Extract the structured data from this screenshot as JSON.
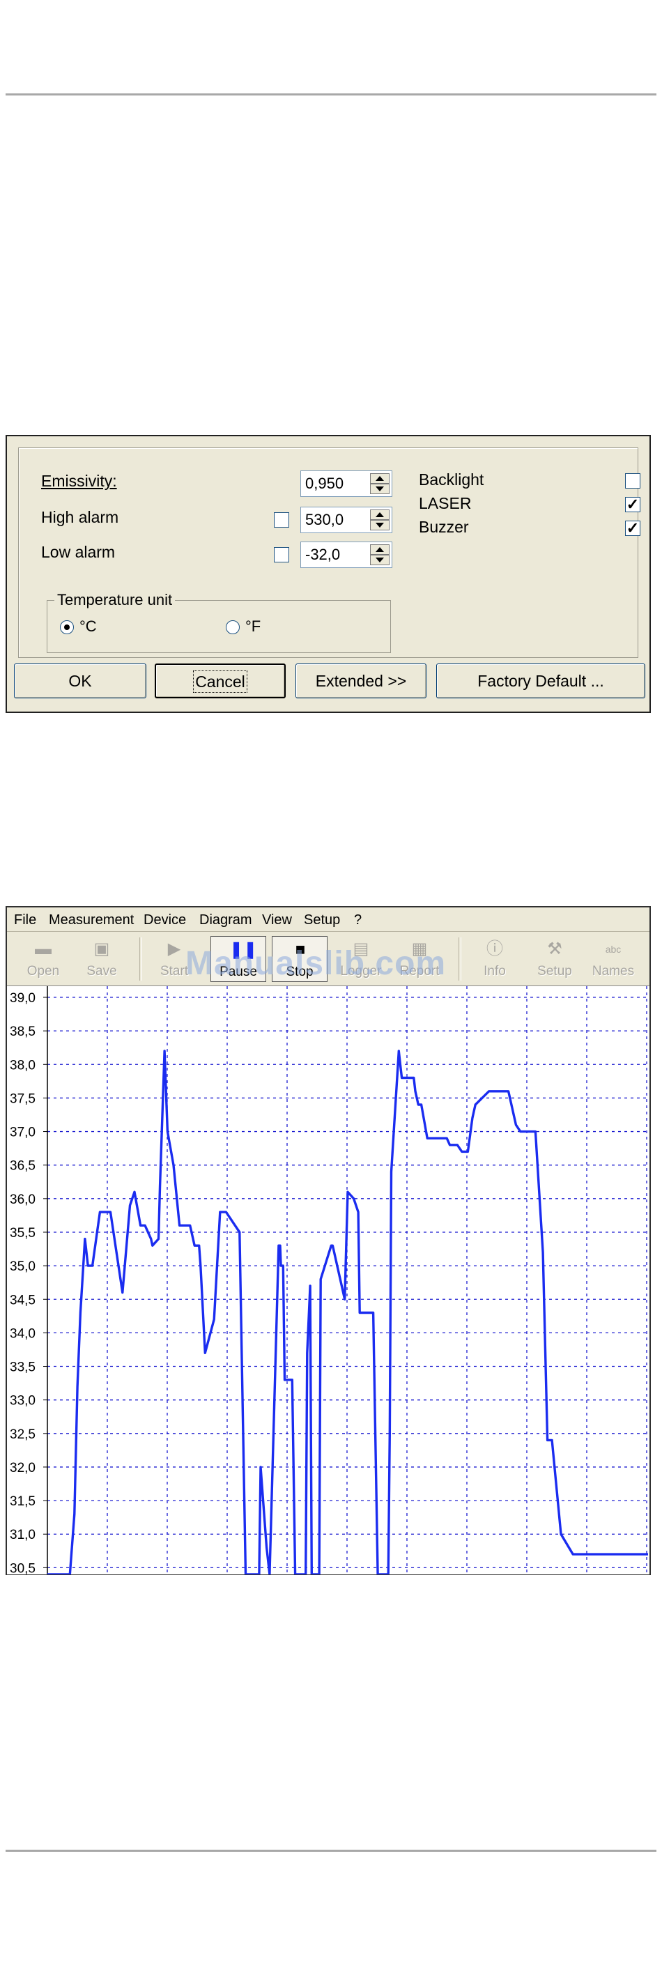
{
  "dialog": {
    "fields": [
      {
        "label": "Emissivity:",
        "value": "0,950",
        "alarm_checked": null
      },
      {
        "label": "High alarm",
        "value": "530,0",
        "alarm_checked": false
      },
      {
        "label": "Low alarm",
        "value": "-32,0",
        "alarm_checked": false
      }
    ],
    "options": [
      {
        "label": "Backlight",
        "checked": false
      },
      {
        "label": "LASER",
        "checked": true
      },
      {
        "label": "Buzzer",
        "checked": true
      }
    ],
    "temperature_unit": {
      "title": "Temperature unit",
      "celsius_label": "°C",
      "fahrenheit_label": "°F",
      "selected": "°C"
    },
    "buttons": {
      "ok": "OK",
      "cancel": "Cancel",
      "extended": "Extended >>",
      "factory_default": "Factory Default ..."
    }
  },
  "app": {
    "menu": [
      "File",
      "Measurement",
      "Device",
      "Diagram",
      "View",
      "Setup",
      "?"
    ],
    "toolbar": [
      {
        "label": "Open",
        "icon": "folder-icon",
        "enabled": false
      },
      {
        "label": "Save",
        "icon": "disk-icon",
        "enabled": false
      },
      {
        "label": "Start",
        "icon": "play-icon",
        "enabled": false
      },
      {
        "label": "Pause",
        "icon": "pause-icon",
        "enabled": true
      },
      {
        "label": "Stop",
        "icon": "stop-icon",
        "enabled": true
      },
      {
        "label": "Logger",
        "icon": "logger-icon",
        "enabled": false
      },
      {
        "label": "Report",
        "icon": "report-icon",
        "enabled": false
      },
      {
        "label": "Info",
        "icon": "info-icon",
        "enabled": false
      },
      {
        "label": "Setup",
        "icon": "tools-icon",
        "enabled": false
      },
      {
        "label": "Names",
        "icon": "names-icon",
        "enabled": false
      }
    ],
    "watermark": "Manualslib.com"
  },
  "chart_data": {
    "type": "line",
    "title": "",
    "xlabel": "",
    "ylabel": "",
    "ylim": [
      30.4,
      39.0
    ],
    "y_ticks": [
      "39,0",
      "38,5",
      "38,0",
      "37,5",
      "37,0",
      "36,5",
      "36,0",
      "35,5",
      "35,0",
      "34,5",
      "34,0",
      "33,5",
      "33,0",
      "32,5",
      "32,0",
      "31,5",
      "31,0",
      "30,5"
    ],
    "grid": true,
    "line_color": "#1a2cf0",
    "series": [
      {
        "x": [
          0,
          10,
          13,
          15,
          18,
          20,
          22,
          25,
          27,
          30,
          35,
          42,
          50,
          55,
          58,
          62,
          65,
          67,
          69,
          70,
          74,
          75,
          78,
          80,
          84,
          88,
          90,
          93,
          95,
          98,
          101,
          102,
          105,
          111,
          115,
          119,
          128,
          132,
          136,
          137,
          141,
          142,
          146,
          148,
          154,
          155,
          155.5,
          157,
          158,
          163,
          165,
          167,
          172,
          173,
          175,
          176,
          178,
          181,
          182,
          189,
          190,
          198,
          200,
          204,
          207,
          208,
          217,
          220,
          226,
          227,
          228,
          229,
          234,
          235,
          236,
          243,
          244,
          245,
          247,
          249,
          253,
          258,
          261,
          262,
          264,
          266,
          268,
          270,
          273,
          276,
          278,
          280,
          283,
          285,
          294,
          304,
          307,
          312,
          315,
          325,
          330,
          333,
          336,
          342,
          350,
          356,
          358,
          364,
          366,
          370,
          390,
          400
        ],
        "values": [
          30.4,
          30.4,
          30.4,
          30.4,
          31.3,
          33.2,
          34.3,
          35.4,
          35.0,
          35.0,
          35.8,
          35.8,
          34.6,
          35.9,
          36.1,
          35.6,
          35.6,
          35.5,
          35.4,
          35.3,
          35.4,
          36.2,
          38.2,
          37.0,
          36.5,
          35.6,
          35.6,
          35.6,
          35.6,
          35.3,
          35.3,
          35.0,
          33.7,
          34.2,
          35.8,
          35.8,
          35.5,
          30.4,
          30.4,
          30.4,
          30.4,
          32.0,
          30.8,
          30.4,
          35.3,
          35.3,
          35.0,
          35.0,
          33.3,
          33.3,
          30.4,
          30.4,
          30.4,
          33.7,
          34.7,
          30.4,
          30.4,
          30.4,
          34.8,
          35.3,
          35.3,
          34.5,
          36.1,
          36.0,
          35.8,
          34.3,
          34.3,
          30.4,
          30.4,
          30.4,
          32.5,
          36.4,
          38.2,
          38.0,
          37.8,
          37.8,
          37.8,
          37.6,
          37.4,
          37.4,
          36.9,
          36.9,
          36.9,
          36.9,
          36.9,
          36.9,
          36.8,
          36.8,
          36.8,
          36.7,
          36.7,
          36.7,
          37.2,
          37.4,
          37.6,
          37.6,
          37.6,
          37.1,
          37.0,
          37.0,
          35.2,
          32.4,
          32.4,
          31.0,
          30.7,
          30.7,
          30.7,
          30.7,
          30.7,
          30.7,
          30.7,
          30.7
        ]
      }
    ]
  }
}
